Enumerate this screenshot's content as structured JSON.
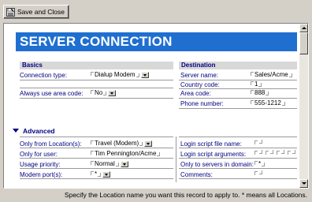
{
  "toolbar": {
    "save_close_label": "Save and Close",
    "save_icon": "save-close-icon"
  },
  "form": {
    "title": "SERVER CONNECTION",
    "basics": {
      "heading": "Basics",
      "connection_type_label": "Connection type:",
      "connection_type_value": "Dialup Modem",
      "always_use_area_code_label": "Always use area code:",
      "always_use_area_code_value": "No"
    },
    "destination": {
      "heading": "Destination",
      "server_name_label": "Server name:",
      "server_name_value": "Sales/Acme",
      "country_code_label": "Country code:",
      "country_code_value": "1",
      "area_code_label": "Area code:",
      "area_code_value": "888",
      "phone_number_label": "Phone number:",
      "phone_number_value": "555-1212"
    },
    "advanced": {
      "heading": "Advanced",
      "only_from_location_label": "Only from Location(s):",
      "only_from_location_value": "Travel (Modem)",
      "only_for_user_label": "Only for user:",
      "only_for_user_value": "Tim Pennington/Acme",
      "usage_priority_label": "Usage priority:",
      "usage_priority_value": "Normal",
      "modem_ports_label": "Modem port(s):",
      "modem_ports_value": "*",
      "login_script_file_label": "Login script file name:",
      "login_script_file_value": "",
      "login_script_args_label": "Login script arguments:",
      "login_script_args_value": "",
      "only_to_servers_label": "Only to servers in domain:",
      "only_to_servers_value": "*",
      "comments_label": "Comments:",
      "comments_value": ""
    }
  },
  "status_bar": {
    "text": "Specify the Location name you want this record to apply to.  * means all Locations."
  },
  "colors": {
    "banner": "#1f6fd0",
    "label": "#000080",
    "window": "#d4d0c8"
  }
}
